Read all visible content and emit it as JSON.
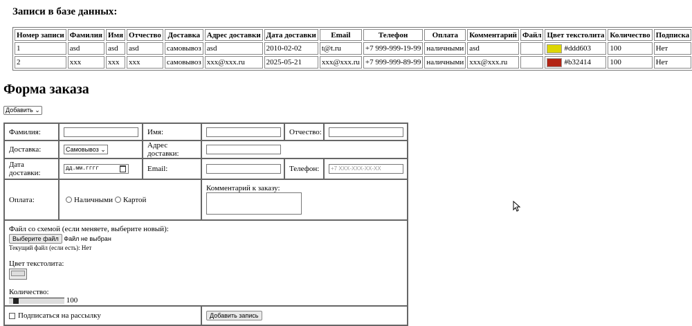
{
  "records": {
    "title": "Записи в базе данных:",
    "headers": [
      "Номер записи",
      "Фамилия",
      "Имя",
      "Отчество",
      "Доставка",
      "Адрес доставки",
      "Дата доставки",
      "Email",
      "Телефон",
      "Оплата",
      "Комментарий",
      "Файл",
      "Цвет текстолита",
      "Количество",
      "Подписка"
    ],
    "rows": [
      {
        "id": "1",
        "last": "asd",
        "first": "asd",
        "middle": "asd",
        "delivery": "самовывоз",
        "address": "asd",
        "date": "2010-02-02",
        "email": "t@t.ru",
        "phone": "+7 999-999-19-99",
        "payment": "наличными",
        "comment": "asd",
        "file": "",
        "color": "#ddd603",
        "qty": "100",
        "sub": "Нет"
      },
      {
        "id": "2",
        "last": "xxx",
        "first": "xxx",
        "middle": "xxx",
        "delivery": "самовывоз",
        "address": "xxx@xxx.ru",
        "date": "2025-05-21",
        "email": "xxx@xxx.ru",
        "phone": "+7 999-999-89-99",
        "payment": "наличными",
        "comment": "xxx@xxx.ru",
        "file": "",
        "color": "#b32414",
        "qty": "100",
        "sub": "Нет"
      }
    ]
  },
  "form": {
    "title": "Форма заказа",
    "mode_select": "Добавить",
    "last_label": "Фамилия:",
    "first_label": "Имя:",
    "middle_label": "Отчество:",
    "delivery_label": "Доставка:",
    "delivery_value": "Самовывоз",
    "address_label": "Адрес доставки:",
    "date_label": "Дата доставки:",
    "date_placeholder": "дд.мм.гггг",
    "email_label": "Email:",
    "phone_label": "Телефон:",
    "phone_placeholder": "+7 XXX-XXX-XX-XX",
    "payment_label": "Оплата:",
    "pay_cash": "Наличными",
    "pay_card": "Картой",
    "comment_label": "Комментарий к заказу:",
    "file_label": "Файл со схемой (если меняете, выберите новый):",
    "file_button": "Выберите файл",
    "file_status": "Файл не выбран",
    "current_file": "Текущий файл (если есть): Нет",
    "color_label": "Цвет текстолита:",
    "qty_label": "Количество:",
    "qty_value": "100",
    "subscribe_label": "Подписаться на рассылку",
    "submit": "Добавить запись"
  }
}
